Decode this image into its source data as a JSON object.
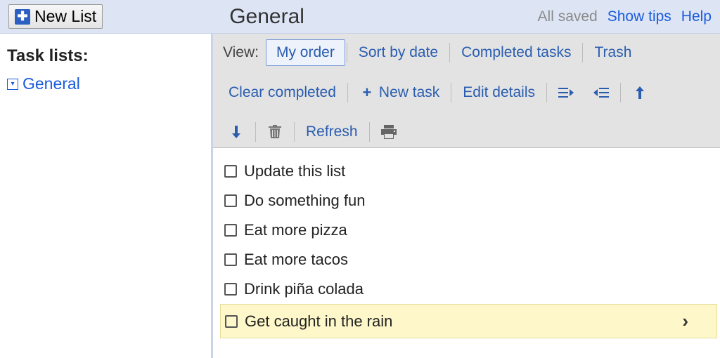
{
  "header": {
    "new_list_label": "New List",
    "title": "General",
    "status": "All saved",
    "show_tips": "Show tips",
    "help": "Help"
  },
  "sidebar": {
    "heading": "Task lists:",
    "items": [
      {
        "label": "General"
      }
    ]
  },
  "toolbar": {
    "view_label": "View:",
    "views": [
      {
        "label": "My order",
        "selected": true
      },
      {
        "label": "Sort by date",
        "selected": false
      },
      {
        "label": "Completed tasks",
        "selected": false
      },
      {
        "label": "Trash",
        "selected": false
      }
    ],
    "clear_completed": "Clear completed",
    "new_task": "New task",
    "edit_details": "Edit details",
    "refresh": "Refresh"
  },
  "tasks": [
    {
      "label": "Update this list",
      "checked": false,
      "selected": false
    },
    {
      "label": "Do something fun",
      "checked": false,
      "selected": false
    },
    {
      "label": "Eat more pizza",
      "checked": false,
      "selected": false
    },
    {
      "label": "Eat more tacos",
      "checked": false,
      "selected": false
    },
    {
      "label": "Drink piña colada",
      "checked": false,
      "selected": false
    },
    {
      "label": "Get caught in the rain",
      "checked": false,
      "selected": true
    }
  ]
}
